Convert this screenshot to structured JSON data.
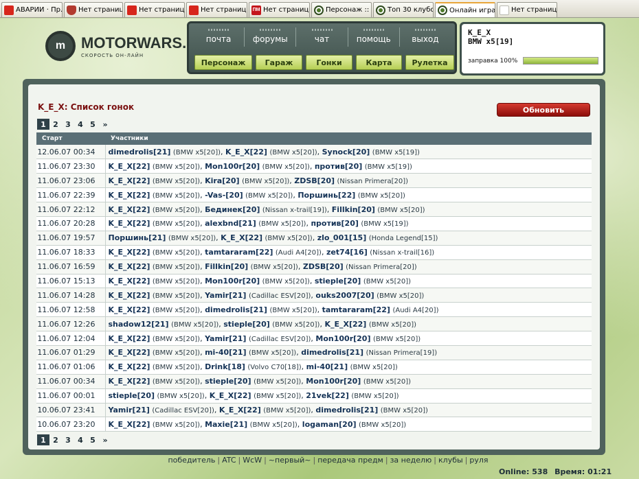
{
  "browser": {
    "tabs": [
      {
        "label": "АВАРИИ · Пр...",
        "icon": "red-square-icon"
      },
      {
        "label": "Нет страниц...",
        "icon": "shield-icon"
      },
      {
        "label": "Нет страниц...",
        "icon": "red-square-icon"
      },
      {
        "label": "Нет страниц...",
        "icon": "red-square-icon"
      },
      {
        "label": "Нет страниц...",
        "icon": "pm-icon",
        "icon_text": "ПМ"
      },
      {
        "label": "Персонаж :: ...",
        "icon": "motorwars-icon"
      },
      {
        "label": "Топ 30 клубо...",
        "icon": "motorwars-icon"
      },
      {
        "label": "Онлайн игра ...",
        "icon": "motorwars-icon",
        "active": true
      },
      {
        "label": "Нет страницы дл...",
        "icon": "blank-page-icon"
      }
    ]
  },
  "logo": {
    "title": "MOTORWARS.RU",
    "subtitle": "СКОРОСТЬ ОН-ЛАЙН",
    "mark": "m"
  },
  "nav": {
    "links": [
      "почта",
      "форумы",
      "чат",
      "помощь",
      "выход"
    ],
    "buttons": [
      "Персонаж",
      "Гараж",
      "Гонки",
      "Карта",
      "Рулетка"
    ]
  },
  "character": {
    "name": "K_E_X",
    "car": "BMW x5[19]",
    "fuel_label": "заправка 100%",
    "fuel_percent": 100
  },
  "main": {
    "title": "K_E_X: Список гонок",
    "refresh_label": "Обновить",
    "pages": [
      "1",
      "2",
      "3",
      "4",
      "5",
      "»"
    ],
    "current_page": "1",
    "columns": [
      "Старт",
      "Участники"
    ],
    "rows": [
      {
        "date": "12.06.07 00:34",
        "p": [
          [
            "dimedrolis[21]",
            "(BMW x5[20])"
          ],
          [
            "K_E_X[22]",
            "(BMW x5[20])"
          ],
          [
            "Synock[20]",
            "(BMW x5[19])"
          ]
        ]
      },
      {
        "date": "11.06.07 23:30",
        "p": [
          [
            "K_E_X[22]",
            "(BMW x5[20])"
          ],
          [
            "Mon100r[20]",
            "(BMW x5[20])"
          ],
          [
            "против[20]",
            "(BMW x5[19])"
          ]
        ]
      },
      {
        "date": "11.06.07 23:06",
        "p": [
          [
            "K_E_X[22]",
            "(BMW x5[20])"
          ],
          [
            "Kira[20]",
            "(BMW x5[20])"
          ],
          [
            "ZDSB[20]",
            "(Nissan Primera[20])"
          ]
        ]
      },
      {
        "date": "11.06.07 22:39",
        "p": [
          [
            "K_E_X[22]",
            "(BMW x5[20])"
          ],
          [
            "-Vas-[20]",
            "(BMW x5[20])"
          ],
          [
            "Поршинь[22]",
            "(BMW x5[20])"
          ]
        ]
      },
      {
        "date": "11.06.07 22:12",
        "p": [
          [
            "K_E_X[22]",
            "(BMW x5[20])"
          ],
          [
            "Бединек[20]",
            "(Nissan x-trail[19])"
          ],
          [
            "Fillkin[20]",
            "(BMW x5[20])"
          ]
        ]
      },
      {
        "date": "11.06.07 20:28",
        "p": [
          [
            "K_E_X[22]",
            "(BMW x5[20])"
          ],
          [
            "alexbnd[21]",
            "(BMW x5[20])"
          ],
          [
            "против[20]",
            "(BMW x5[19])"
          ]
        ]
      },
      {
        "date": "11.06.07 19:57",
        "p": [
          [
            "Поршинь[21]",
            "(BMW x5[20])"
          ],
          [
            "K_E_X[22]",
            "(BMW x5[20])"
          ],
          [
            "zlo_001[15]",
            "(Honda Legend[15])"
          ]
        ]
      },
      {
        "date": "11.06.07 18:33",
        "p": [
          [
            "K_E_X[22]",
            "(BMW x5[20])"
          ],
          [
            "tamtararam[22]",
            "(Audi A4[20])"
          ],
          [
            "zet74[16]",
            "(Nissan x-trail[16])"
          ]
        ]
      },
      {
        "date": "11.06.07 16:59",
        "p": [
          [
            "K_E_X[22]",
            "(BMW x5[20])"
          ],
          [
            "Fillkin[20]",
            "(BMW x5[20])"
          ],
          [
            "ZDSB[20]",
            "(Nissan Primera[20])"
          ]
        ]
      },
      {
        "date": "11.06.07 15:13",
        "p": [
          [
            "K_E_X[22]",
            "(BMW x5[20])"
          ],
          [
            "Mon100r[20]",
            "(BMW x5[20])"
          ],
          [
            "stieple[20]",
            "(BMW x5[20])"
          ]
        ]
      },
      {
        "date": "11.06.07 14:28",
        "p": [
          [
            "K_E_X[22]",
            "(BMW x5[20])"
          ],
          [
            "Yamir[21]",
            "(Cadillac ESV[20])"
          ],
          [
            "ouks2007[20]",
            "(BMW x5[20])"
          ]
        ]
      },
      {
        "date": "11.06.07 12:58",
        "p": [
          [
            "K_E_X[22]",
            "(BMW x5[20])"
          ],
          [
            "dimedrolis[21]",
            "(BMW x5[20])"
          ],
          [
            "tamtararam[22]",
            "(Audi A4[20])"
          ]
        ]
      },
      {
        "date": "11.06.07 12:26",
        "p": [
          [
            "shadow12[21]",
            "(BMW x5[20])"
          ],
          [
            "stieple[20]",
            "(BMW x5[20])"
          ],
          [
            "K_E_X[22]",
            "(BMW x5[20])"
          ]
        ]
      },
      {
        "date": "11.06.07 12:04",
        "p": [
          [
            "K_E_X[22]",
            "(BMW x5[20])"
          ],
          [
            "Yamir[21]",
            "(Cadillac ESV[20])"
          ],
          [
            "Mon100r[20]",
            "(BMW x5[20])"
          ]
        ]
      },
      {
        "date": "11.06.07 01:29",
        "p": [
          [
            "K_E_X[22]",
            "(BMW x5[20])"
          ],
          [
            "mi-40[21]",
            "(BMW x5[20])"
          ],
          [
            "dimedrolis[21]",
            "(Nissan Primera[19])"
          ]
        ]
      },
      {
        "date": "11.06.07 01:06",
        "p": [
          [
            "K_E_X[22]",
            "(BMW x5[20])"
          ],
          [
            "Drink[18]",
            "(Volvo C70[18])"
          ],
          [
            "mi-40[21]",
            "(BMW x5[20])"
          ]
        ]
      },
      {
        "date": "11.06.07 00:34",
        "p": [
          [
            "K_E_X[22]",
            "(BMW x5[20])"
          ],
          [
            "stieple[20]",
            "(BMW x5[20])"
          ],
          [
            "Mon100r[20]",
            "(BMW x5[20])"
          ]
        ]
      },
      {
        "date": "11.06.07 00:01",
        "p": [
          [
            "stieple[20]",
            "(BMW x5[20])"
          ],
          [
            "K_E_X[22]",
            "(BMW x5[20])"
          ],
          [
            "21vek[22]",
            "(BMW x5[20])"
          ]
        ]
      },
      {
        "date": "10.06.07 23:41",
        "p": [
          [
            "Yamir[21]",
            "(Cadillac ESV[20])"
          ],
          [
            "K_E_X[22]",
            "(BMW x5[20])"
          ],
          [
            "dimedrolis[21]",
            "(BMW x5[20])"
          ]
        ]
      },
      {
        "date": "10.06.07 23:20",
        "p": [
          [
            "K_E_X[22]",
            "(BMW x5[20])"
          ],
          [
            "Maxie[21]",
            "(BMW x5[20])"
          ],
          [
            "logaman[20]",
            "(BMW x5[20])"
          ]
        ]
      }
    ]
  },
  "footer": {
    "links": [
      "победитель",
      "ATC",
      "WcW",
      "~первый~",
      "передача предм",
      "за неделю",
      "клубы",
      "руля"
    ],
    "online_label": "Online:",
    "online_count": "538",
    "time_label": "Время:",
    "time_value": "01:21"
  },
  "colors": {
    "accent_red": "#b0170f",
    "nav_green": "#c8df6e",
    "panel_dark": "#4f625c",
    "header_teal": "#5a6f76"
  }
}
